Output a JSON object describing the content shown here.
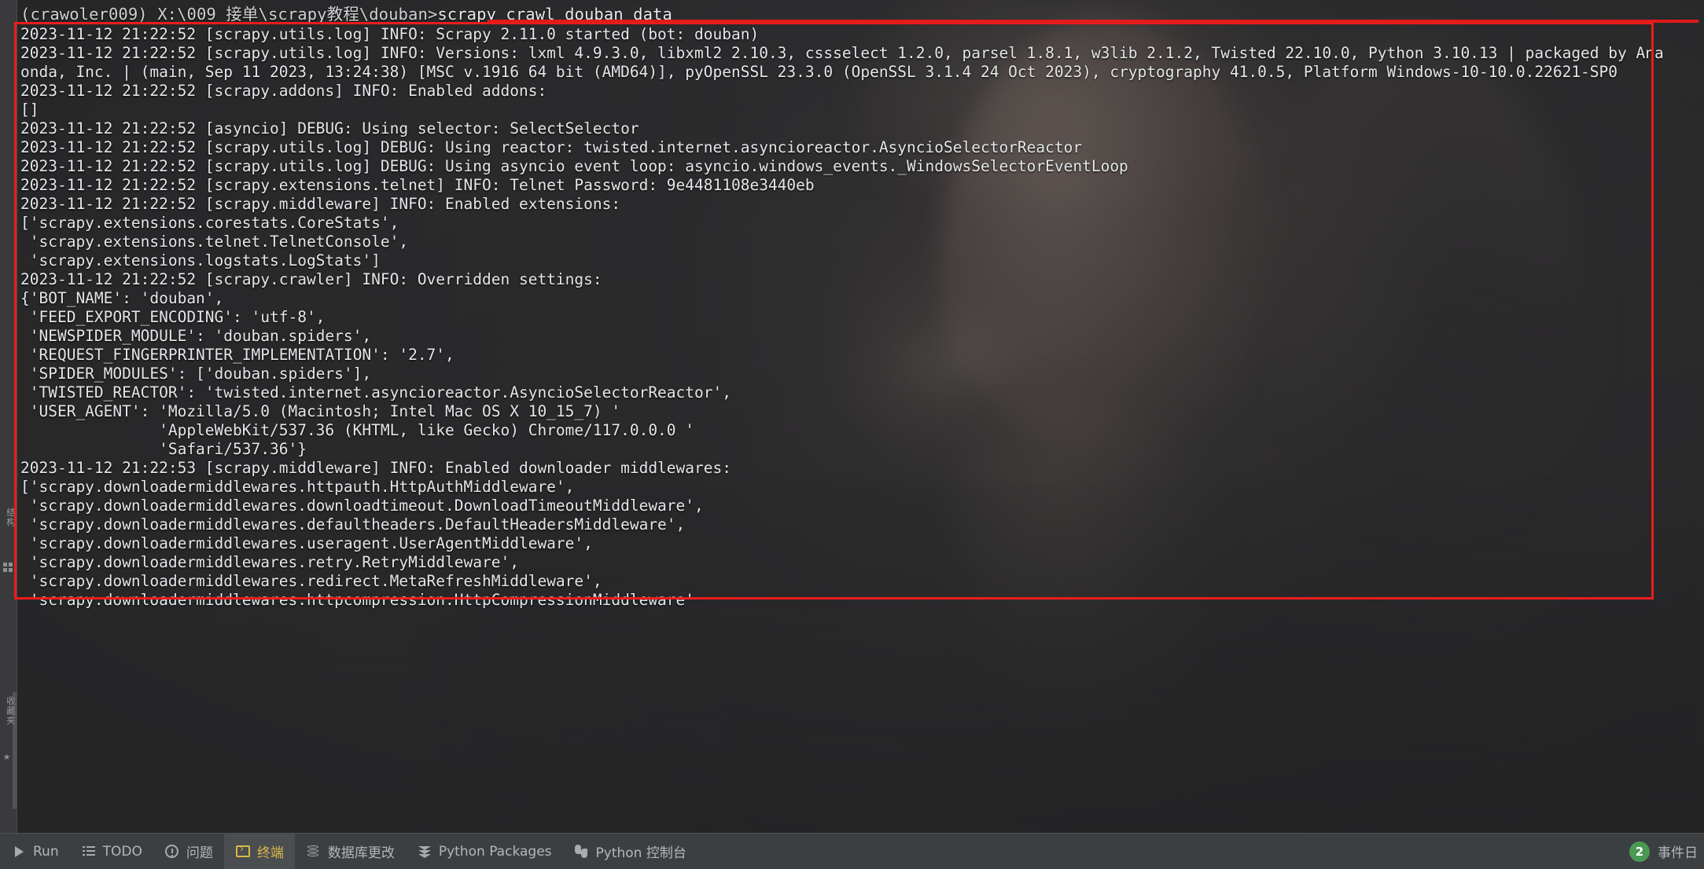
{
  "window": {
    "app": "PyCharm Terminal",
    "accent_red": "#ec1c1c",
    "accent_yellow": "#ddb948",
    "badge_green": "#4a9a54"
  },
  "terminal": {
    "prompt_env": "(crawoler009) ",
    "prompt_path": "X:\\009_接单\\scrapy教程\\douban>",
    "command": "scrapy crawl douban_data",
    "lines": [
      "2023-11-12 21:22:52 [scrapy.utils.log] INFO: Scrapy 2.11.0 started (bot: douban)",
      "2023-11-12 21:22:52 [scrapy.utils.log] INFO: Versions: lxml 4.9.3.0, libxml2 2.10.3, cssselect 1.2.0, parsel 1.8.1, w3lib 2.1.2, Twisted 22.10.0, Python 3.10.13 | packaged by Ana",
      "onda, Inc. | (main, Sep 11 2023, 13:24:38) [MSC v.1916 64 bit (AMD64)], pyOpenSSL 23.3.0 (OpenSSL 3.1.4 24 Oct 2023), cryptography 41.0.5, Platform Windows-10-10.0.22621-SP0",
      "2023-11-12 21:22:52 [scrapy.addons] INFO: Enabled addons:",
      "[]",
      "2023-11-12 21:22:52 [asyncio] DEBUG: Using selector: SelectSelector",
      "2023-11-12 21:22:52 [scrapy.utils.log] DEBUG: Using reactor: twisted.internet.asyncioreactor.AsyncioSelectorReactor",
      "2023-11-12 21:22:52 [scrapy.utils.log] DEBUG: Using asyncio event loop: asyncio.windows_events._WindowsSelectorEventLoop",
      "2023-11-12 21:22:52 [scrapy.extensions.telnet] INFO: Telnet Password: 9e4481108e3440eb",
      "2023-11-12 21:22:52 [scrapy.middleware] INFO: Enabled extensions:",
      "['scrapy.extensions.corestats.CoreStats',",
      " 'scrapy.extensions.telnet.TelnetConsole',",
      " 'scrapy.extensions.logstats.LogStats']",
      "2023-11-12 21:22:52 [scrapy.crawler] INFO: Overridden settings:",
      "{'BOT_NAME': 'douban',",
      " 'FEED_EXPORT_ENCODING': 'utf-8',",
      " 'NEWSPIDER_MODULE': 'douban.spiders',",
      " 'REQUEST_FINGERPRINTER_IMPLEMENTATION': '2.7',",
      " 'SPIDER_MODULES': ['douban.spiders'],",
      " 'TWISTED_REACTOR': 'twisted.internet.asyncioreactor.AsyncioSelectorReactor',",
      " 'USER_AGENT': 'Mozilla/5.0 (Macintosh; Intel Mac OS X 10_15_7) '",
      "               'AppleWebKit/537.36 (KHTML, like Gecko) Chrome/117.0.0.0 '",
      "               'Safari/537.36'}",
      "2023-11-12 21:22:53 [scrapy.middleware] INFO: Enabled downloader middlewares:",
      "['scrapy.downloadermiddlewares.httpauth.HttpAuthMiddleware',",
      " 'scrapy.downloadermiddlewares.downloadtimeout.DownloadTimeoutMiddleware',",
      " 'scrapy.downloadermiddlewares.defaultheaders.DefaultHeadersMiddleware',",
      " 'scrapy.downloadermiddlewares.useragent.UserAgentMiddleware',",
      " 'scrapy.downloadermiddlewares.retry.RetryMiddleware',",
      " 'scrapy.downloadermiddlewares.redirect.MetaRefreshMiddleware',",
      " 'scrapy.downloadermiddlewares.httpcompression.HttpCompressionMiddleware'"
    ]
  },
  "left_strip": {
    "structure_label": "结构",
    "favorites_label": "收藏夹",
    "structure_icon": "structure-icon",
    "favorites_icon": "star-icon"
  },
  "bottom_bar": {
    "items": [
      {
        "label": "Run",
        "icon": "run-icon",
        "active": false
      },
      {
        "label": "TODO",
        "icon": "todo-icon",
        "active": false
      },
      {
        "label": "问题",
        "icon": "problems-icon",
        "active": false
      },
      {
        "label": "终端",
        "icon": "terminal-icon",
        "active": true
      },
      {
        "label": "数据库更改",
        "icon": "database-icon",
        "active": false
      },
      {
        "label": "Python Packages",
        "icon": "python-packages-icon",
        "active": false
      },
      {
        "label": "Python 控制台",
        "icon": "python-icon",
        "active": false
      }
    ],
    "event_log": {
      "count": "2",
      "label": "事件日"
    }
  }
}
